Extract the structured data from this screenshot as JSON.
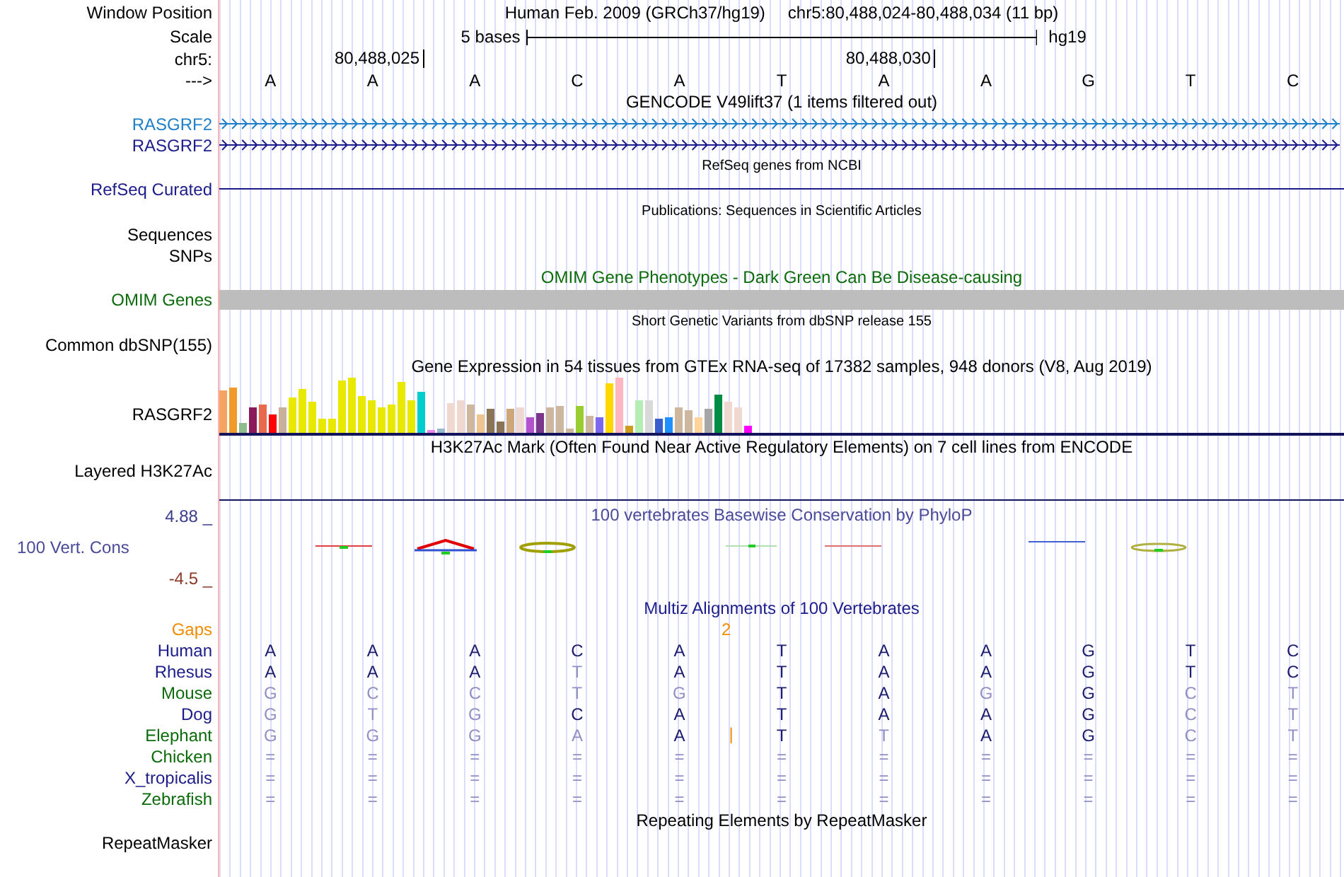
{
  "position": {
    "label": "Window Position",
    "assembly": "Human Feb. 2009 (GRCh37/hg19)",
    "range": "chr5:80,488,024-80,488,034 (11 bp)"
  },
  "scale": {
    "label": "Scale",
    "length": "5 bases",
    "assembly": "hg19"
  },
  "coordinates": {
    "label": "chr5:",
    "ticks": [
      "80,488,025",
      "80,488,030"
    ]
  },
  "sequence": {
    "label": "--->",
    "bases": [
      "A",
      "A",
      "A",
      "C",
      "A",
      "T",
      "A",
      "A",
      "G",
      "T",
      "C"
    ]
  },
  "tracks": [
    {
      "kind": "title",
      "text": "GENCODE V49lift37 (1 items filtered out)",
      "small": false,
      "color": "#000000"
    },
    {
      "kind": "gene",
      "label": "RASGRF2",
      "color": "#1f7fc8"
    },
    {
      "kind": "gene",
      "label": "RASGRF2",
      "color": "#1c1c8a"
    },
    {
      "kind": "title",
      "text": "RefSeq genes from NCBI",
      "small": true,
      "color": "#000000"
    },
    {
      "kind": "line",
      "label": "RefSeq Curated",
      "color": "#1c1c8a"
    },
    {
      "kind": "title",
      "text": "Publications: Sequences in Scientific Articles",
      "small": true,
      "color": "#000000"
    },
    {
      "kind": "label",
      "label": "Sequences"
    },
    {
      "kind": "label",
      "label": "SNPs"
    },
    {
      "kind": "title",
      "text": "OMIM Gene Phenotypes - Dark Green Can Be Disease-causing",
      "small": false,
      "color": "#0b6b0b"
    },
    {
      "kind": "bar",
      "label": "OMIM Genes",
      "color": "#0b6b0b"
    },
    {
      "kind": "title",
      "text": "Short Genetic Variants from dbSNP release 155",
      "small": true,
      "color": "#000000"
    },
    {
      "kind": "label",
      "label": "Common dbSNP(155)"
    },
    {
      "kind": "title",
      "text": "Gene Expression in 54 tissues from GTEx RNA-seq of 17382 samples, 948 donors (V8, Aug 2019)",
      "small": false,
      "color": "#000000"
    },
    {
      "kind": "expression",
      "label": "RASGRF2"
    },
    {
      "kind": "title",
      "text": "H3K27Ac Mark (Often Found Near Active Regulatory Elements) on 7 cell lines from ENCODE",
      "small": false,
      "color": "#000000"
    },
    {
      "kind": "layered",
      "label": "Layered H3K27Ac"
    },
    {
      "kind": "conservation",
      "title": "100 vertebrates Basewise Conservation by PhyloP",
      "label": "100 Vert. Cons",
      "max": "4.88 _",
      "min": "-4.5 _"
    },
    {
      "kind": "title",
      "text": "Multiz Alignments of 100 Vertebrates",
      "small": false,
      "color": "#1c1c8a"
    },
    {
      "kind": "gaps",
      "label": "Gaps",
      "mark": "2"
    },
    {
      "kind": "species",
      "label": "Human",
      "color": "#1c1c8a",
      "bases": [
        {
          "b": "A",
          "match": true
        },
        {
          "b": "A",
          "match": true
        },
        {
          "b": "A",
          "match": true
        },
        {
          "b": "C",
          "match": true
        },
        {
          "b": "A",
          "match": true
        },
        {
          "b": "T",
          "match": true
        },
        {
          "b": "A",
          "match": true
        },
        {
          "b": "A",
          "match": true
        },
        {
          "b": "G",
          "match": true
        },
        {
          "b": "T",
          "match": true
        },
        {
          "b": "C",
          "match": true
        }
      ]
    },
    {
      "kind": "species",
      "label": "Rhesus",
      "color": "#1c1c8a",
      "bases": [
        {
          "b": "A",
          "match": true
        },
        {
          "b": "A",
          "match": true
        },
        {
          "b": "A",
          "match": true
        },
        {
          "b": "T",
          "match": false
        },
        {
          "b": "A",
          "match": true
        },
        {
          "b": "T",
          "match": true
        },
        {
          "b": "A",
          "match": true
        },
        {
          "b": "A",
          "match": true
        },
        {
          "b": "G",
          "match": true
        },
        {
          "b": "T",
          "match": true
        },
        {
          "b": "C",
          "match": true
        }
      ]
    },
    {
      "kind": "species",
      "label": "Mouse",
      "color": "#0b6b0b",
      "bases": [
        {
          "b": "G",
          "match": false
        },
        {
          "b": "C",
          "match": false
        },
        {
          "b": "C",
          "match": false
        },
        {
          "b": "T",
          "match": false
        },
        {
          "b": "G",
          "match": false
        },
        {
          "b": "T",
          "match": true
        },
        {
          "b": "A",
          "match": true
        },
        {
          "b": "G",
          "match": false
        },
        {
          "b": "G",
          "match": true
        },
        {
          "b": "C",
          "match": false
        },
        {
          "b": "T",
          "match": false
        }
      ]
    },
    {
      "kind": "species",
      "label": "Dog",
      "color": "#1c1c8a",
      "bases": [
        {
          "b": "G",
          "match": false
        },
        {
          "b": "T",
          "match": false
        },
        {
          "b": "G",
          "match": false
        },
        {
          "b": "C",
          "match": true
        },
        {
          "b": "A",
          "match": true
        },
        {
          "b": "T",
          "match": true
        },
        {
          "b": "A",
          "match": true
        },
        {
          "b": "A",
          "match": true
        },
        {
          "b": "G",
          "match": true
        },
        {
          "b": "C",
          "match": false
        },
        {
          "b": "T",
          "match": false
        }
      ]
    },
    {
      "kind": "species",
      "label": "Elephant",
      "color": "#0b6b0b",
      "bases": [
        {
          "b": "G",
          "match": false
        },
        {
          "b": "G",
          "match": false
        },
        {
          "b": "G",
          "match": false
        },
        {
          "b": "A",
          "match": false
        },
        {
          "b": "A",
          "match": true,
          "insertion": "|"
        },
        {
          "b": "T",
          "match": true
        },
        {
          "b": "T",
          "match": false
        },
        {
          "b": "A",
          "match": true
        },
        {
          "b": "G",
          "match": true
        },
        {
          "b": "C",
          "match": false
        },
        {
          "b": "T",
          "match": false
        }
      ]
    },
    {
      "kind": "species",
      "label": "Chicken",
      "color": "#0b6b0b",
      "bases": [
        {
          "b": "=",
          "match": false
        },
        {
          "b": "=",
          "match": false
        },
        {
          "b": "=",
          "match": false
        },
        {
          "b": "=",
          "match": false
        },
        {
          "b": "=",
          "match": false
        },
        {
          "b": "=",
          "match": false
        },
        {
          "b": "=",
          "match": false
        },
        {
          "b": "=",
          "match": false
        },
        {
          "b": "=",
          "match": false
        },
        {
          "b": "=",
          "match": false
        },
        {
          "b": "=",
          "match": false
        }
      ]
    },
    {
      "kind": "species",
      "label": "X_tropicalis",
      "color": "#1c1c8a",
      "bases": [
        {
          "b": "=",
          "match": false
        },
        {
          "b": "=",
          "match": false
        },
        {
          "b": "=",
          "match": false
        },
        {
          "b": "=",
          "match": false
        },
        {
          "b": "=",
          "match": false
        },
        {
          "b": "=",
          "match": false
        },
        {
          "b": "=",
          "match": false
        },
        {
          "b": "=",
          "match": false
        },
        {
          "b": "=",
          "match": false
        },
        {
          "b": "=",
          "match": false
        },
        {
          "b": "=",
          "match": false
        }
      ]
    },
    {
      "kind": "species",
      "label": "Zebrafish",
      "color": "#0b6b0b",
      "bases": [
        {
          "b": "=",
          "match": false
        },
        {
          "b": "=",
          "match": false
        },
        {
          "b": "=",
          "match": false
        },
        {
          "b": "=",
          "match": false
        },
        {
          "b": "=",
          "match": false
        },
        {
          "b": "=",
          "match": false
        },
        {
          "b": "=",
          "match": false
        },
        {
          "b": "=",
          "match": false
        },
        {
          "b": "=",
          "match": false
        },
        {
          "b": "=",
          "match": false
        },
        {
          "b": "=",
          "match": false
        }
      ]
    },
    {
      "kind": "title",
      "text": "Repeating Elements by RepeatMasker",
      "small": false,
      "color": "#000000"
    },
    {
      "kind": "label",
      "label": "RepeatMasker"
    }
  ]
}
